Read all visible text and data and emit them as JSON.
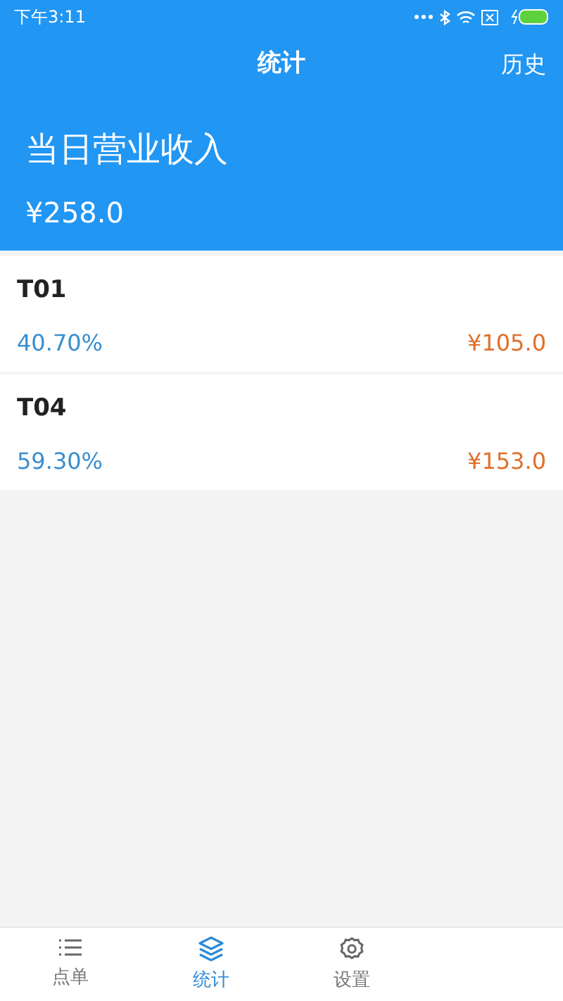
{
  "status_bar": {
    "time": "下午3:11"
  },
  "header": {
    "title": "统计",
    "action": "历史"
  },
  "summary": {
    "label": "当日营业收入",
    "amount": "¥258.0"
  },
  "items": [
    {
      "name": "T01",
      "percent": "40.70%",
      "amount": "¥105.0"
    },
    {
      "name": "T04",
      "percent": "59.30%",
      "amount": "¥153.0"
    }
  ],
  "tabs": [
    {
      "label": "点单",
      "kind": "list",
      "selected": false
    },
    {
      "label": "统计",
      "kind": "layers",
      "selected": true
    },
    {
      "label": "设置",
      "kind": "gear",
      "selected": false
    }
  ]
}
